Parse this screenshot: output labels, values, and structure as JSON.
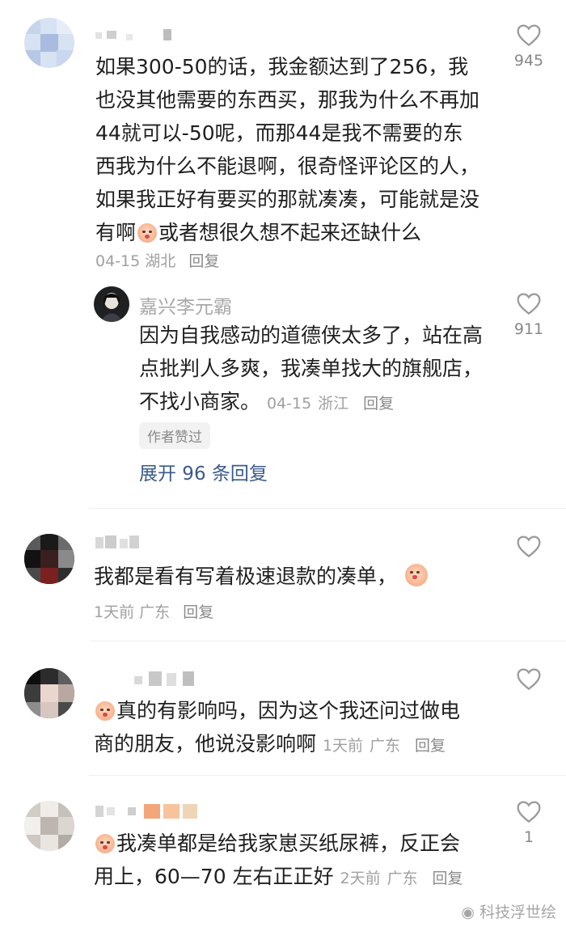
{
  "comments": [
    {
      "username": "",
      "text_lines": [
        "如果300-50的话，我金额达到了256，我",
        "也没其他需要的东西买，那我为什么不再加",
        "44就可以-50呢，而那44是我不需要的东",
        "西我为什么不能退啊，很奇怪评论区的人，",
        "如果我正好有要买的那就凑凑，可能就是没"
      ],
      "last_line_before_emoji": "有啊",
      "last_line_after_emoji": "或者想很久想不起来还缺什么",
      "date": "04-15",
      "location": "湖北",
      "reply_label": "回复",
      "like_count": "945"
    },
    {
      "username": "嘉兴李元霸",
      "text_lines": [
        "因为自我感动的道德侠太多了，站在高",
        "点批判人多爽，我凑单找大的旗舰店，"
      ],
      "last_line": "不找小商家。",
      "date": "04-15",
      "location": "浙江",
      "reply_label": "回复",
      "like_count": "911",
      "author_badge": "作者赞过",
      "expand_label": "展开 96 条回复"
    },
    {
      "username": "",
      "text": "我都是看有写着极速退款的凑单，",
      "date": "1天前",
      "location": "广东",
      "reply_label": "回复",
      "like_count": ""
    },
    {
      "username": "",
      "line1": "真的有影响吗，因为这个我还问过做电",
      "line2": "商的朋友，他说没影响啊",
      "date": "1天前",
      "location": "广东",
      "reply_label": "回复",
      "like_count": ""
    },
    {
      "username": "",
      "line1": "我凑单都是给我家崽买纸尿裤，反正会",
      "line2": "用上，60—70 左右正正好",
      "date": "2天前",
      "location": "广东",
      "reply_label": "回复",
      "like_count": "1"
    }
  ],
  "icons": {
    "like": "heart-outline-icon",
    "emoji": "crying-face-emoji-icon"
  },
  "colors": {
    "link": "#3a5a8c",
    "meta": "#a0a0a0"
  },
  "watermark": "科技浮世绘"
}
